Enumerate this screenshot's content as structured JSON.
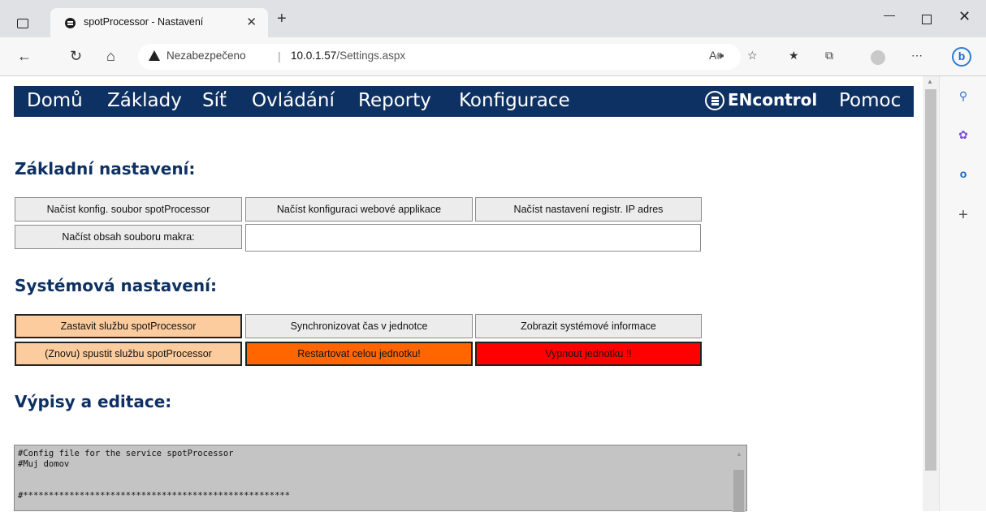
{
  "browser": {
    "tab_title": "spotProcessor - Nastavení",
    "tab_close": "✕",
    "new_tab": "+",
    "security_label": "Nezabezpečeno",
    "url_host": "10.0.1.57",
    "url_path": "/Settings.aspx",
    "window_min": "—",
    "window_close": "✕"
  },
  "nav": {
    "items": [
      "Domů",
      "Základy",
      "Síť",
      "Ovládání",
      "Reporty",
      "Konfigurace"
    ],
    "brand": "ENcontrol",
    "help": "Pomoc"
  },
  "sections": {
    "basic": {
      "title": "Základní nastavení:",
      "buttons": [
        "Načíst konfig. soubor spotProcessor",
        "Načíst konfiguraci webové applikace",
        "Načíst nastavení registr. IP adres",
        "Načíst obsah souboru makra:"
      ],
      "macro_value": ""
    },
    "system": {
      "title": "Systémová nastavení:",
      "buttons": [
        "Zastavit službu spotProcessor",
        "Synchronizovat čas v jednotce",
        "Zobrazit systémové informace",
        "(Znovu) spustit službu spotProcessor",
        "Restartovat celou jednotku!",
        "Vypnout jednotku !!"
      ]
    },
    "listings": {
      "title": "Výpisy a editace:",
      "content": "#Config file for the service spotProcessor\n#Muj domov\n\n\n#****************************************************"
    }
  },
  "colors": {
    "nav_bg": "#0e3163",
    "peach": "#fdcc9e",
    "orange": "#ff6600",
    "red": "#ff0000"
  },
  "icons": {
    "back": "back-arrow-icon",
    "refresh": "refresh-icon",
    "home": "home-icon",
    "warning": "warning-icon",
    "search": "search-icon",
    "copilot": "copilot-icon",
    "outlook": "outlook-icon",
    "add": "plus-icon"
  }
}
